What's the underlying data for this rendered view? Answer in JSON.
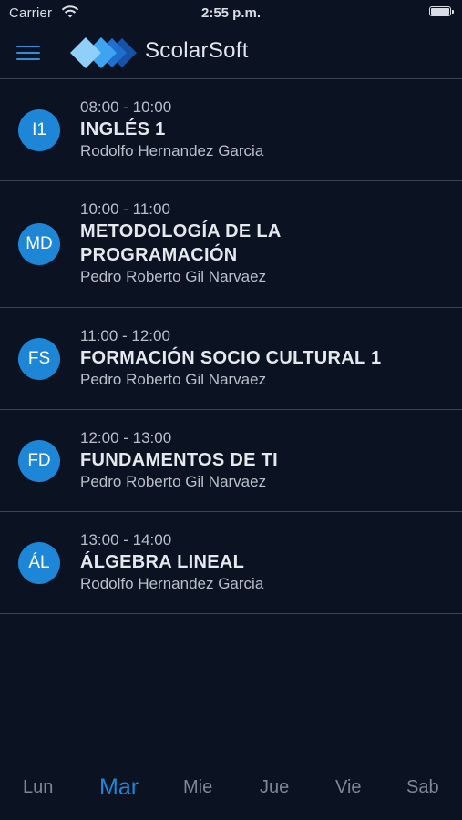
{
  "status_bar": {
    "carrier": "Carrier",
    "time": "2:55 p.m."
  },
  "header": {
    "app_title": "ScolarSoft"
  },
  "classes": [
    {
      "initials": "I1",
      "time": "08:00 - 10:00",
      "name": "INGLÉS 1",
      "teacher": "Rodolfo Hernandez Garcia"
    },
    {
      "initials": "MD",
      "time": "10:00 - 11:00",
      "name": "METODOLOGÍA DE LA PROGRAMACIÓN",
      "teacher": "Pedro Roberto Gil Narvaez"
    },
    {
      "initials": "FS",
      "time": "11:00 - 12:00",
      "name": "FORMACIÓN SOCIO CULTURAL 1",
      "teacher": "Pedro Roberto Gil Narvaez"
    },
    {
      "initials": "FD",
      "time": "12:00 - 13:00",
      "name": "FUNDAMENTOS DE TI",
      "teacher": "Pedro Roberto Gil Narvaez"
    },
    {
      "initials": "ÁL",
      "time": "13:00 - 14:00",
      "name": "ÁLGEBRA LINEAL",
      "teacher": "Rodolfo Hernandez Garcia"
    }
  ],
  "day_tabs": {
    "selected": "Mar",
    "items": [
      "Lun",
      "Mar",
      "Mie",
      "Jue",
      "Vie",
      "Sab"
    ]
  },
  "colors": {
    "background": "#0b1322",
    "accent": "#1e86d6",
    "divider": "#3a4453"
  }
}
